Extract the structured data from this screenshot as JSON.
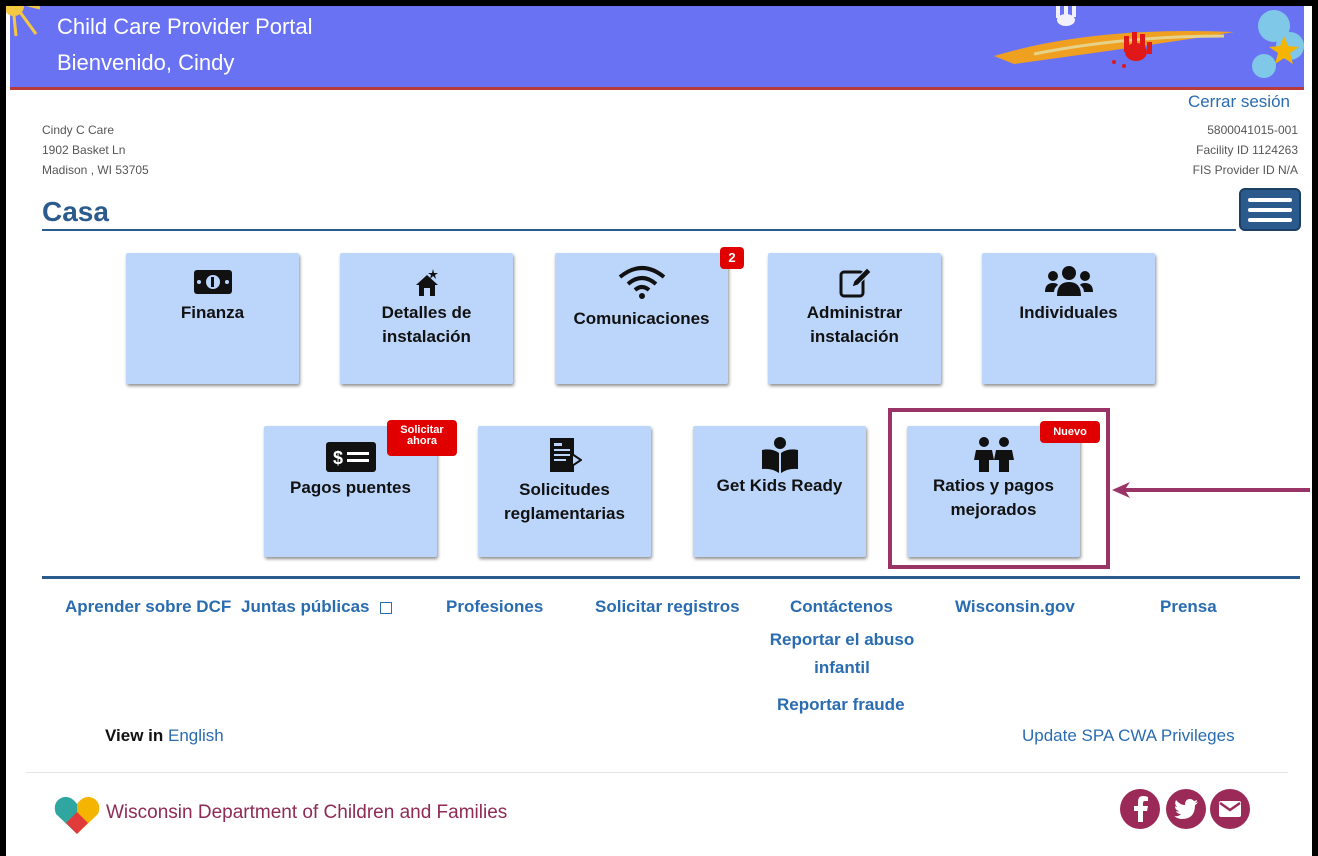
{
  "header": {
    "title": "Child Care Provider Portal",
    "welcome": "Bienvenido, Cindy"
  },
  "account": {
    "name": "Cindy C Care",
    "address1": "1902 Basket Ln",
    "address2": "Madison , WI 53705",
    "logout": "Cerrar sesión",
    "provider_number": "5800041015-001",
    "facility_id": "Facility ID 1124263",
    "fis_id": "FIS Provider ID N/A"
  },
  "page": {
    "title": "Casa"
  },
  "tiles_row1": [
    {
      "icon": "money-icon",
      "label": "Finanza"
    },
    {
      "icon": "house-icon",
      "label": "Detalles de instalación"
    },
    {
      "icon": "wifi-icon",
      "label": "Comunicaciones",
      "badge": "2"
    },
    {
      "icon": "edit-icon",
      "label": "Administrar instalación"
    },
    {
      "icon": "people-icon",
      "label": "Individuales"
    }
  ],
  "tiles_row2": [
    {
      "icon": "check-icon",
      "label": "Pagos puentes",
      "badge": "Solicitar ahora"
    },
    {
      "icon": "form-icon",
      "label": "Solicitudes reglamentarias"
    },
    {
      "icon": "book-reader-icon",
      "label": "Get Kids Ready"
    },
    {
      "icon": "children-icon",
      "label": "Ratios y pagos mejorados",
      "badge": "Nuevo"
    }
  ],
  "footer": {
    "links": [
      "Aprender sobre DCF",
      "Juntas públicas",
      "Profesiones",
      "Solicitar registros",
      "Contáctenos",
      "Wisconsin.gov",
      "Prensa"
    ],
    "report_abuse": "Reportar el abuso infantil",
    "report_fraud": "Reportar fraude",
    "view_in": "View in",
    "language": "English",
    "spa": "Update SPA CWA Privileges",
    "org_name": "Wisconsin Department of Children and Families"
  },
  "colors": {
    "banner": "#6a72f4",
    "tile": "#bcd6fb",
    "accent": "#2b5b8c",
    "link": "#2a6cb0",
    "badge": "#e00000",
    "highlight": "#9a3466"
  }
}
